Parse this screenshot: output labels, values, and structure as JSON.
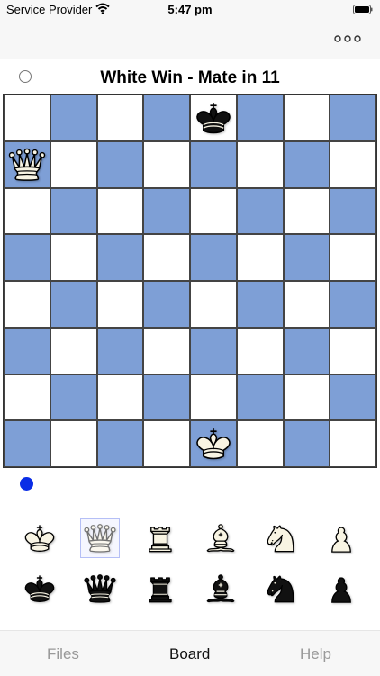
{
  "status_bar": {
    "carrier": "Service Provider",
    "time": "5:47 pm"
  },
  "nav": {
    "more_icon": "ellipsis-icon"
  },
  "title": "White Win - Mate in 11",
  "turn_indicator": {
    "top": "empty",
    "bottom": "filled",
    "color": "#0a2de6"
  },
  "board": {
    "colors": {
      "light": "#ffffff",
      "dark": "#7e9fd6"
    },
    "pieces": [
      {
        "piece": "black-king",
        "square": "e8"
      },
      {
        "piece": "white-queen",
        "square": "a7"
      },
      {
        "piece": "white-king",
        "square": "e1"
      }
    ]
  },
  "palette": {
    "white": [
      "king",
      "queen",
      "rook",
      "bishop",
      "knight",
      "pawn"
    ],
    "black": [
      "king",
      "queen",
      "rook",
      "bishop",
      "knight",
      "pawn"
    ],
    "selected": "white-queen"
  },
  "tabs": [
    {
      "label": "Files",
      "active": false
    },
    {
      "label": "Board",
      "active": true
    },
    {
      "label": "Help",
      "active": false
    }
  ]
}
